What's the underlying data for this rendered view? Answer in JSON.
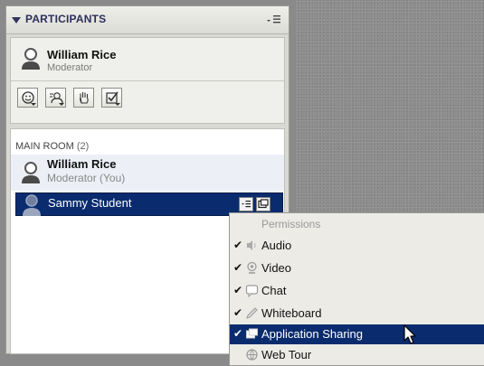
{
  "participants_panel": {
    "title": "PARTICIPANTS",
    "host": {
      "name": "William Rice",
      "role": "Moderator"
    },
    "toolbar_buttons": [
      {
        "icon": "smiley-icon"
      },
      {
        "icon": "profile-icon"
      },
      {
        "icon": "raise-hand-icon"
      },
      {
        "icon": "poll-check-icon"
      }
    ],
    "main_room": {
      "label": "MAIN ROOM",
      "count": "(2)",
      "attendees": [
        {
          "name": "William Rice",
          "role": "Moderator (You)"
        },
        {
          "name": "Sammy Student"
        }
      ]
    }
  },
  "context_menu": {
    "header": "Permissions",
    "items": [
      {
        "label": "Audio",
        "checked": "✔",
        "icon": "speaker-icon"
      },
      {
        "label": "Video",
        "checked": "✔",
        "icon": "webcam-icon"
      },
      {
        "label": "Chat",
        "checked": "✔",
        "icon": "chat-bubble-icon"
      },
      {
        "label": "Whiteboard",
        "checked": "✔",
        "icon": "pencil-icon"
      },
      {
        "label": "Application Sharing",
        "checked": "✔",
        "icon": "app-sharing-icon",
        "highlighted": true
      },
      {
        "label": "Web Tour",
        "checked": "",
        "icon": "globe-icon"
      }
    ]
  },
  "colors": {
    "selection": "#0a2c6e",
    "panel_title": "#2b2f5c",
    "canvas": "#8c8c8c"
  }
}
